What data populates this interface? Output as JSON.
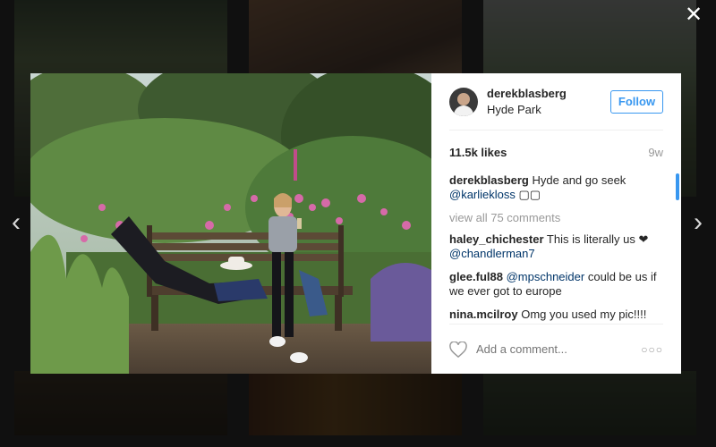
{
  "post": {
    "username": "derekblasberg",
    "location": "Hyde Park",
    "follow_label": "Follow",
    "likes": "11.5k likes",
    "age": "9w",
    "caption": {
      "user": "derekblasberg",
      "text": "Hyde and go seek",
      "mention": "@karliekloss",
      "emoji": "▢▢"
    },
    "view_all": "view all 75 comments",
    "comments": [
      {
        "user": "haley_chichester",
        "text": "This is literally us ❤",
        "mention": "@chandlerman7",
        "mention_first": false
      },
      {
        "user": "glee.ful88",
        "mention": "@mpschneider",
        "text": "could be us if we ever got to europe",
        "mention_first": true
      },
      {
        "user": "nina.mcilroy",
        "text": "Omg you used my pic!!!! Hahahaha was so awesome meeting you both xx love us",
        "mention": "",
        "mention_first": false
      }
    ],
    "add_comment_placeholder": "Add a comment...",
    "more_label": "○○○"
  },
  "controls": {
    "close_label": "✕",
    "prev_label": "‹",
    "next_label": "›"
  },
  "icons": {
    "heart": "heart-icon",
    "close": "close-icon",
    "prev": "chevron-left-icon",
    "next": "chevron-right-icon",
    "more": "more-options-icon"
  },
  "colors": {
    "accent": "#3897f0",
    "mention": "#003569",
    "muted": "#999999",
    "text": "#262626"
  }
}
